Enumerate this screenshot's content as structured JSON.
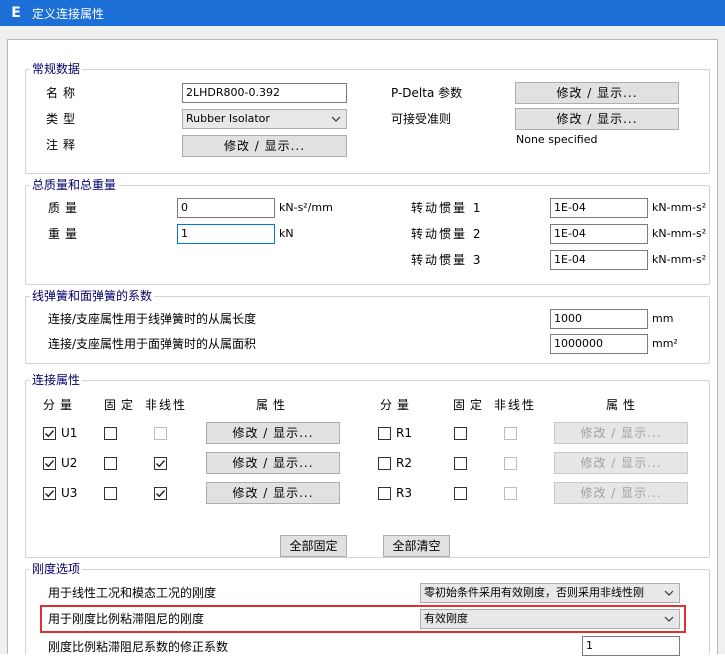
{
  "window": {
    "title": "定义连接属性",
    "app_icon": "E"
  },
  "general": {
    "legend": "常规数据",
    "name_label": "名称",
    "name_value": "2LHDR800-0.392",
    "type_label": "类型",
    "type_value": "Rubber Isolator",
    "note_label": "注释",
    "note_button": "修改 / 显示...",
    "pdelta_label": "P-Delta 参数",
    "pdelta_button": "修改 / 显示...",
    "accept_label": "可接受准则",
    "accept_button": "修改 / 显示...",
    "accept_status": "None specified"
  },
  "mass": {
    "legend": "总质量和总重量",
    "mass_label": "质量",
    "mass_value": "0",
    "mass_unit": "kN-s²/mm",
    "weight_label": "重量",
    "weight_value": "1",
    "weight_unit": "kN",
    "inertia1_label": "转动惯量 1",
    "inertia1_value": "1E-04",
    "inertia2_label": "转动惯量 2",
    "inertia2_value": "1E-04",
    "inertia3_label": "转动惯量 3",
    "inertia3_value": "1E-04",
    "inertia_unit": "kN-mm-s²"
  },
  "springs": {
    "legend": "线弹簧和面弹簧的系数",
    "line_label": "连接/支座属性用于线弹簧时的从属长度",
    "line_value": "1000",
    "line_unit": "mm",
    "area_label": "连接/支座属性用于面弹簧时的从属面积",
    "area_value": "1000000",
    "area_unit": "mm²"
  },
  "dof": {
    "legend": "连接属性",
    "headers": {
      "component": "分量",
      "fixed": "固定",
      "nonlinear": "非线性",
      "props": "属性"
    },
    "left": [
      {
        "label": "U1",
        "checked": true,
        "fixed": false,
        "nonlinear": false,
        "nonlinear_enabled": false,
        "button": "修改 / 显示...",
        "enabled": true
      },
      {
        "label": "U2",
        "checked": true,
        "fixed": false,
        "nonlinear": true,
        "nonlinear_enabled": true,
        "button": "修改 / 显示...",
        "enabled": true
      },
      {
        "label": "U3",
        "checked": true,
        "fixed": false,
        "nonlinear": true,
        "nonlinear_enabled": true,
        "button": "修改 / 显示...",
        "enabled": true
      }
    ],
    "right": [
      {
        "label": "R1",
        "checked": false,
        "fixed": false,
        "nonlinear": false,
        "nonlinear_enabled": false,
        "button": "修改 / 显示...",
        "enabled": false
      },
      {
        "label": "R2",
        "checked": false,
        "fixed": false,
        "nonlinear": false,
        "nonlinear_enabled": false,
        "button": "修改 / 显示...",
        "enabled": false
      },
      {
        "label": "R3",
        "checked": false,
        "fixed": false,
        "nonlinear": false,
        "nonlinear_enabled": false,
        "button": "修改 / 显示...",
        "enabled": false
      }
    ],
    "fix_all_button": "全部固定",
    "clear_all_button": "全部清空"
  },
  "stiffness": {
    "legend": "刚度选项",
    "linear_label": "用于线性工况和模态工况的刚度",
    "linear_value": "零初始条件采用有效刚度，否则采用非线性刚",
    "damping_label": "用于刚度比例粘滞阻尼的刚度",
    "damping_value": "有效刚度",
    "coef_label": "刚度比例粘滞阻尼系数的修正系数",
    "coef_value": "1"
  },
  "colors": {
    "titlebar": "#1b6fd6",
    "legend": "#00006a",
    "highlight": "#e03030"
  }
}
